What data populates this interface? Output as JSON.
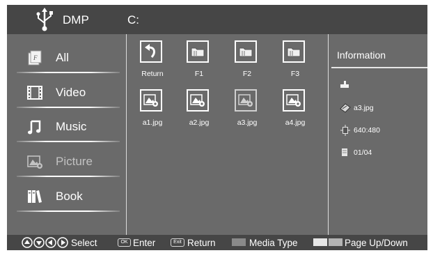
{
  "header": {
    "app_title": "DMP",
    "path": "C:",
    "usb_icon": "usb-icon"
  },
  "sidebar": {
    "items": [
      {
        "label": "All",
        "icon": "all-media-icon",
        "state": "normal"
      },
      {
        "label": "Video",
        "icon": "film-icon",
        "state": "normal"
      },
      {
        "label": "Music",
        "icon": "music-note-icon",
        "state": "normal"
      },
      {
        "label": "Picture",
        "icon": "picture-icon",
        "state": "selected"
      },
      {
        "label": "Book",
        "icon": "book-icon",
        "state": "normal"
      }
    ]
  },
  "files": {
    "items": [
      {
        "label": "Return",
        "icon": "return-arrow-icon"
      },
      {
        "label": "F1",
        "icon": "folder-icon"
      },
      {
        "label": "F2",
        "icon": "folder-icon"
      },
      {
        "label": "F3",
        "icon": "folder-icon"
      },
      {
        "label": "a1.jpg",
        "icon": "image-file-icon"
      },
      {
        "label": "a2.jpg",
        "icon": "image-file-icon"
      },
      {
        "label": "a3.jpg",
        "icon": "image-file-icon"
      },
      {
        "label": "a4.jpg",
        "icon": "image-file-icon"
      }
    ]
  },
  "info": {
    "title": "Information",
    "rows": [
      {
        "icon": "drive-icon",
        "text": ""
      },
      {
        "icon": "tag-icon",
        "text": "a3.jpg"
      },
      {
        "icon": "resolution-icon",
        "text": "640:480"
      },
      {
        "icon": "page-icon",
        "text": "01/04"
      }
    ]
  },
  "footer": {
    "select": "Select",
    "ok_key": "OK",
    "enter": "Enter",
    "exit_key": "Exit",
    "return": "Return",
    "media_type": "Media Type",
    "page_updown": "Page Up/Down",
    "colors": {
      "media_type_swatch": "#8a8a8a",
      "page_swatch_a": "#e6e6e6",
      "page_swatch_b": "#b4b4b4"
    }
  },
  "colors": {
    "screen_bg": "#6a6a6a",
    "bar_bg": "#464646",
    "text": "#ffffff",
    "disabled_text": "#c2c2c2"
  }
}
